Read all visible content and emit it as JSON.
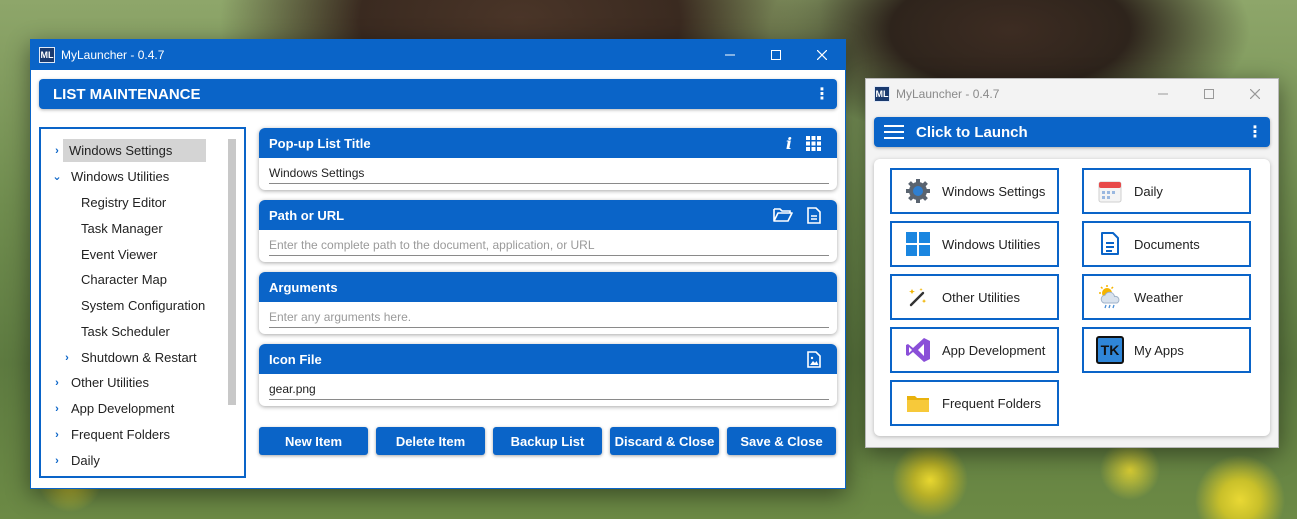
{
  "main_window": {
    "app_icon": "ML",
    "title": "MyLauncher - 0.4.7",
    "header": "LIST MAINTENANCE",
    "tree": [
      {
        "label": "Windows Settings",
        "chevron": "›",
        "selected": true
      },
      {
        "label": "Windows Utilities",
        "chevron": "⌄"
      },
      {
        "label": "Registry Editor",
        "chevron": ""
      },
      {
        "label": "Task Manager",
        "chevron": ""
      },
      {
        "label": "Event Viewer",
        "chevron": ""
      },
      {
        "label": "Character Map",
        "chevron": ""
      },
      {
        "label": "System Configuration",
        "chevron": ""
      },
      {
        "label": "Task Scheduler",
        "chevron": ""
      },
      {
        "label": "Shutdown & Restart",
        "chevron": "›"
      },
      {
        "label": "Other Utilities",
        "chevron": "›"
      },
      {
        "label": "App Development",
        "chevron": "›"
      },
      {
        "label": "Frequent Folders",
        "chevron": "›"
      },
      {
        "label": "Daily",
        "chevron": "›"
      }
    ],
    "fields": [
      {
        "label": "Pop-up List Title",
        "value": "Windows Settings",
        "placeholder": ""
      },
      {
        "label": "Path or URL",
        "value": "",
        "placeholder": "Enter the complete path to the document, application, or URL"
      },
      {
        "label": "Arguments",
        "value": "",
        "placeholder": "Enter any arguments here."
      },
      {
        "label": "Icon File",
        "value": "gear.png",
        "placeholder": ""
      }
    ],
    "buttons": [
      "New Item",
      "Delete Item",
      "Backup List",
      "Discard & Close",
      "Save & Close"
    ]
  },
  "side_window": {
    "app_icon": "ML",
    "title": "MyLauncher - 0.4.7",
    "header": "Click to Launch",
    "tiles": [
      {
        "label": "Windows Settings",
        "icon": "gear-icon"
      },
      {
        "label": "Daily",
        "icon": "calendar-icon"
      },
      {
        "label": "Windows Utilities",
        "icon": "windows-logo-icon"
      },
      {
        "label": "Documents",
        "icon": "document-icon"
      },
      {
        "label": "Other Utilities",
        "icon": "magic-wand-icon"
      },
      {
        "label": "Weather",
        "icon": "weather-icon"
      },
      {
        "label": "App Development",
        "icon": "visual-studio-icon"
      },
      {
        "label": "My Apps",
        "icon": "tk-icon",
        "icon_text": "TK"
      },
      {
        "label": "Frequent Folders",
        "icon": "folder-icon"
      }
    ]
  },
  "colors": {
    "accent": "#0a64c8",
    "folder": "#f5c518",
    "vs_purple": "#8a4fd8"
  }
}
